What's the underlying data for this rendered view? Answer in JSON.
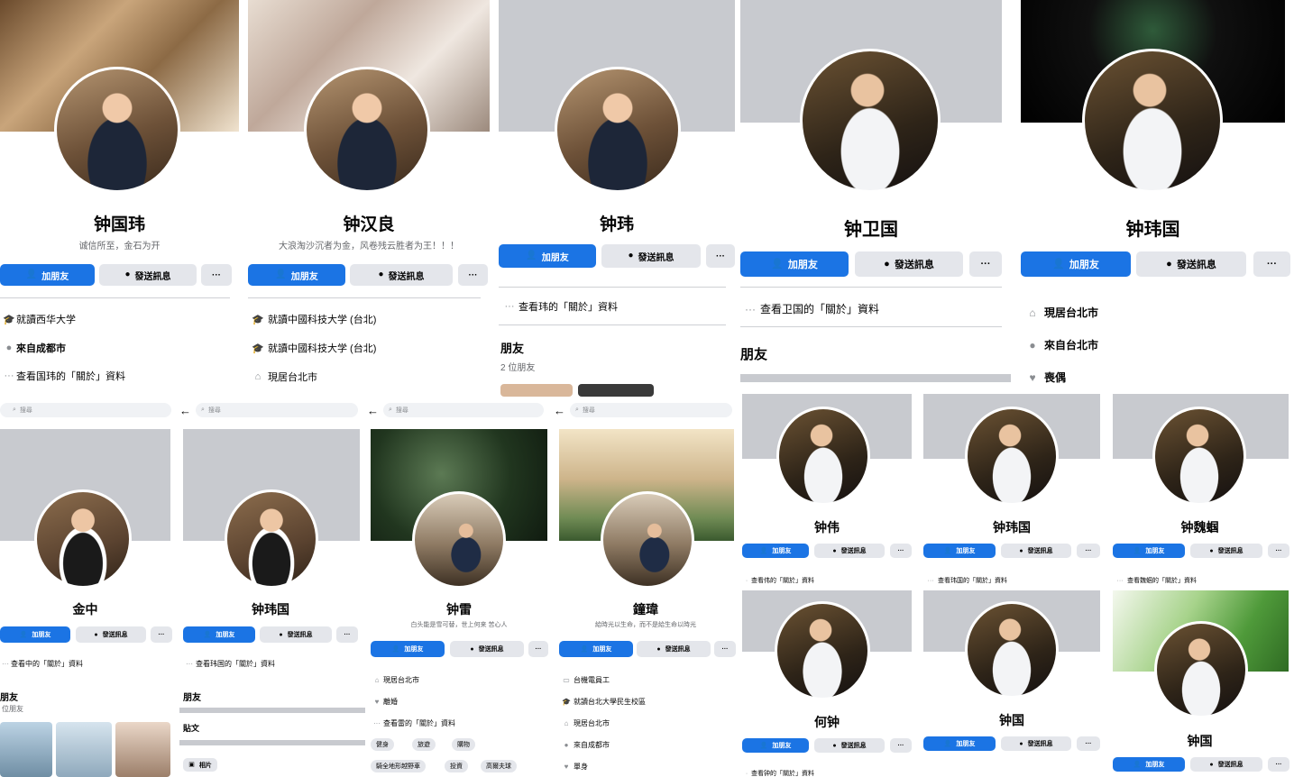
{
  "common": {
    "add_friend": "加朋友",
    "send_message": "發送訊息",
    "more": "···",
    "search_placeholder": "搜尋",
    "friends": "朋友",
    "posts": "貼文",
    "photos": "相片"
  },
  "icons": {
    "add_friend": "person-plus-icon",
    "messenger": "messenger-icon",
    "school": "graduation-cap-icon",
    "location": "location-pin-icon",
    "home": "house-icon",
    "heart": "heart-icon",
    "briefcase": "briefcase-icon",
    "more": "ellipsis-icon",
    "back": "back-arrow-icon",
    "search": "search-icon"
  },
  "colors": {
    "primary": "#1b74e4",
    "secondary": "#e4e6eb",
    "text": "#050505",
    "muted": "#65676b"
  },
  "profiles": {
    "p1": {
      "name": "钟国玮",
      "bio": "诚信所至，金石为开",
      "info": [
        "就讀西华大学",
        "來自成都市",
        "查看国玮的「關於」資料"
      ],
      "info_bold": "成都市"
    },
    "p2": {
      "name": "钟汉良",
      "bio": "大浪淘沙沉者为金，风卷残云胜者为王！！！",
      "info": [
        "就讀中國科技大学 (台北)",
        "就讀中國科技大学 (台北)",
        "現居台北市"
      ]
    },
    "p3": {
      "name": "钟玮",
      "about": "查看玮的「關於」資料",
      "friends_count": "2 位朋友"
    },
    "p4": {
      "name": "钟卫国",
      "about": "查看卫国的「關於」資料"
    },
    "p5": {
      "name": "钟玮国",
      "info": [
        "現居台北市",
        "來自台北市",
        "喪偶"
      ]
    },
    "p6": {
      "name": "金中",
      "about": "查看中的「關於」資料",
      "friends_count": "位朋友"
    },
    "p7": {
      "name": "钟玮国",
      "about": "查看玮国的「關於」資料"
    },
    "p8": {
      "name": "钟雷",
      "bio": "白头能是雪可替，世上何来 苦心人",
      "info": [
        "現居台北市",
        "離婚",
        "查看雷的「關於」資料"
      ],
      "chips": [
        "健身",
        "旅遊",
        "購物",
        "騎全地形越野車",
        "投資",
        "高爾夫球"
      ]
    },
    "p9": {
      "name": "鐘瑋",
      "bio": "給時光以生命，而不是給生命以時光",
      "info": [
        "台機電員工",
        "就讀台北大學民生校區",
        "現居台北市",
        "來自成都市",
        "單身"
      ]
    },
    "p10": {
      "name": "钟伟",
      "about": "查看伟的「關於」資料"
    },
    "p11": {
      "name": "钟玮国",
      "about": "查看玮国的「關於」資料"
    },
    "p12": {
      "name": "钟魏蝈",
      "about": "查看魏蝈的「關於」資料"
    },
    "p13": {
      "name": "何钟",
      "about": "查看钟的「關於」資料"
    },
    "p14": {
      "name": "钟国"
    },
    "p15": {
      "name": "钟国"
    }
  }
}
